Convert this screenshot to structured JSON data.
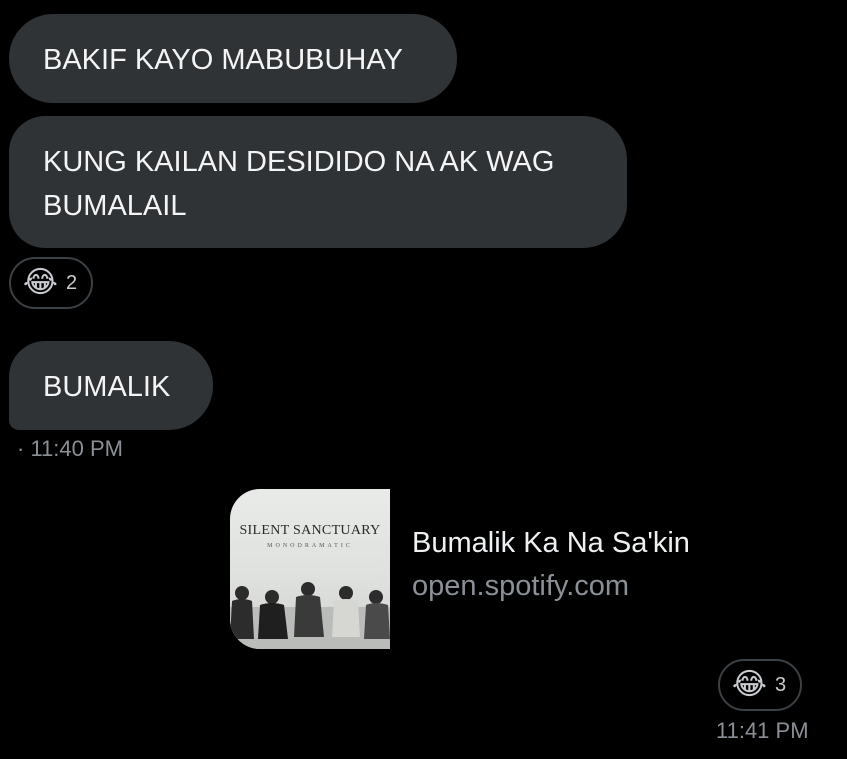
{
  "messages": [
    {
      "text": "BAKIF KAYO MABUBUHAY"
    },
    {
      "text": "KUNG KAILAN DESIDIDO NA AK WAG BUMALAIL"
    },
    {
      "text": "BUMALIK"
    }
  ],
  "reaction_1": {
    "emoji": "😂",
    "count": "2"
  },
  "received_time": "· 11:40 PM",
  "link_card": {
    "title": "Bumalik Ka Na Sa'kin",
    "domain": "open.spotify.com",
    "album_title": "SILENT SANCTUARY",
    "album_subtitle": "MONODRAMATIC"
  },
  "reaction_2": {
    "emoji": "😂",
    "count": "3"
  },
  "sent_time": "11:41 PM"
}
